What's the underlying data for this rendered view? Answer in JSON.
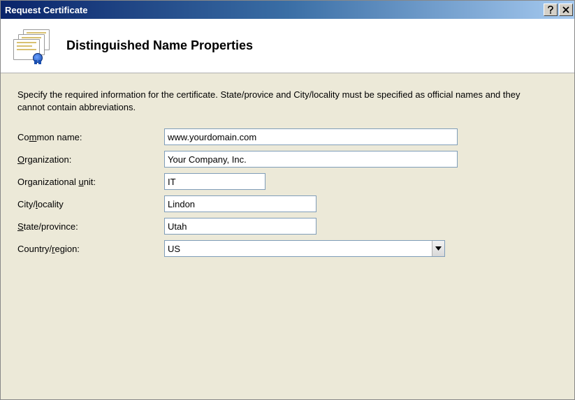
{
  "titlebar": {
    "title": "Request Certificate"
  },
  "header": {
    "title": "Distinguished Name Properties"
  },
  "instructions": "Specify the required information for the certificate. State/provice and City/locality must be specified as official names and they cannot contain abbreviations.",
  "fields": {
    "common_name": {
      "label_pre": "Co",
      "label_mn": "m",
      "label_post": "mon name:",
      "value": "www.yourdomain.com"
    },
    "organization": {
      "label_mn": "O",
      "label_post": "rganization:",
      "value": "Your Company, Inc."
    },
    "org_unit": {
      "label_pre": "Organizational ",
      "label_mn": "u",
      "label_post": "nit:",
      "value": "IT"
    },
    "city": {
      "label_pre": "City/",
      "label_mn": "l",
      "label_post": "ocality",
      "value": "Lindon"
    },
    "state": {
      "label_mn": "S",
      "label_post": "tate/province:",
      "value": "Utah"
    },
    "country": {
      "label_pre": "Country/",
      "label_mn": "r",
      "label_post": "egion:",
      "value": "US"
    }
  }
}
